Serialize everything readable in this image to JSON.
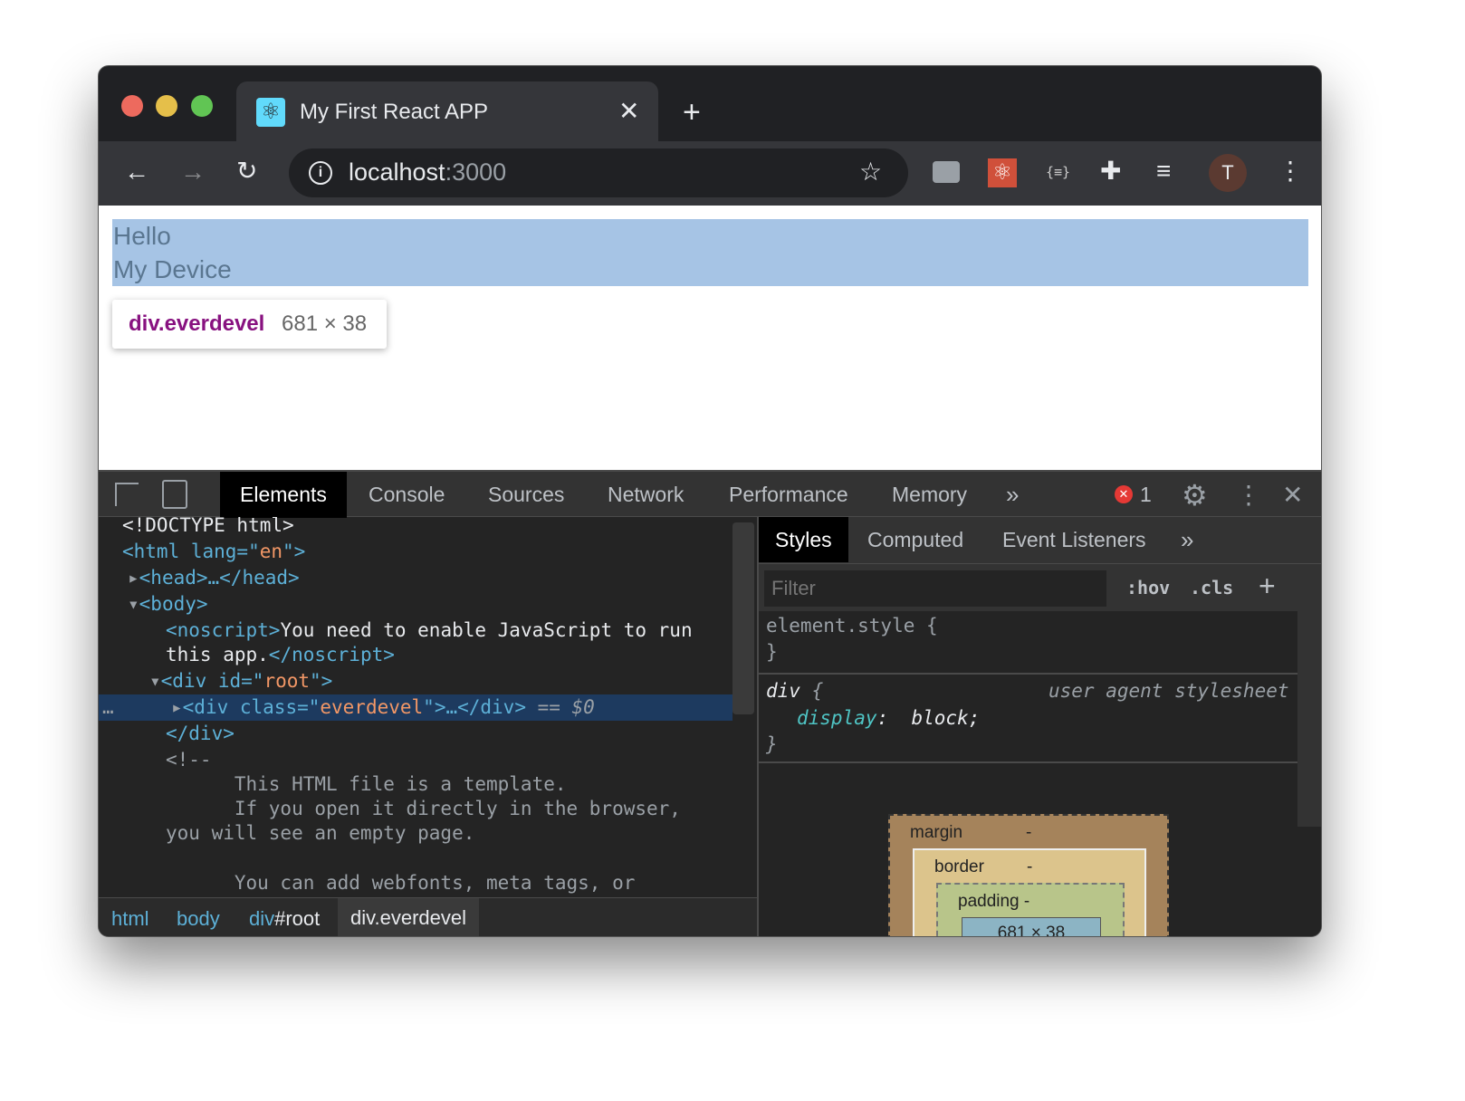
{
  "browser": {
    "tab_title": "My First React APP",
    "url_host": "localhost",
    "url_port": ":3000",
    "avatar": "T",
    "colors": {
      "close": "#ed6a5e",
      "minimize": "#e5bf4a",
      "maximize": "#61c554"
    }
  },
  "page": {
    "lines": [
      "Hello",
      "My Device"
    ],
    "tooltip": {
      "selector": "div.everdevel",
      "size": "681 × 38"
    },
    "highlight_color": "#a6c4e5"
  },
  "devtools": {
    "tabs": [
      "Elements",
      "Console",
      "Sources",
      "Network",
      "Performance",
      "Memory",
      "»"
    ],
    "error_count": "1",
    "dom": {
      "l1": "<!DOCTYPE html>",
      "l2a": "<html lang=\"",
      "l2b": "en",
      "l2c": "\">",
      "l3": "<head>…</head>",
      "l4": "<body>",
      "l5a": "<noscript>",
      "l5b": "You need to enable JavaScript to run",
      "l6a": "this app.",
      "l6b": "</noscript>",
      "l7a": "<div id=\"",
      "l7b": "root",
      "l7c": "\">",
      "l8a": "<div class=\"",
      "l8b": "everdevel",
      "l8c": "\">…</div>",
      "l8d": " == $0",
      "l9": "</div>",
      "l10": "<!--",
      "l11": "      This HTML file is a template.",
      "l12": "      If you open it directly in the browser,",
      "l13": "you will see an empty page.",
      "l14": "      You can add webfonts, meta tags, or"
    },
    "breadcrumbs": [
      "html",
      "body",
      "div",
      "#root",
      "div.everdevel"
    ],
    "side_tabs": [
      "Styles",
      "Computed",
      "Event Listeners",
      "»"
    ],
    "filter_placeholder": "Filter",
    "hov": ":hov",
    "cls": ".cls",
    "rules": {
      "r1": "element.style {",
      "close": "}",
      "r2sel": "div",
      "r2brace": " {",
      "source": "user agent stylesheet",
      "prop": "display",
      "value": " block;"
    },
    "box": {
      "margin": "margin",
      "border": "border",
      "padding": "padding",
      "dash": "-",
      "content": "681 × 38"
    }
  }
}
